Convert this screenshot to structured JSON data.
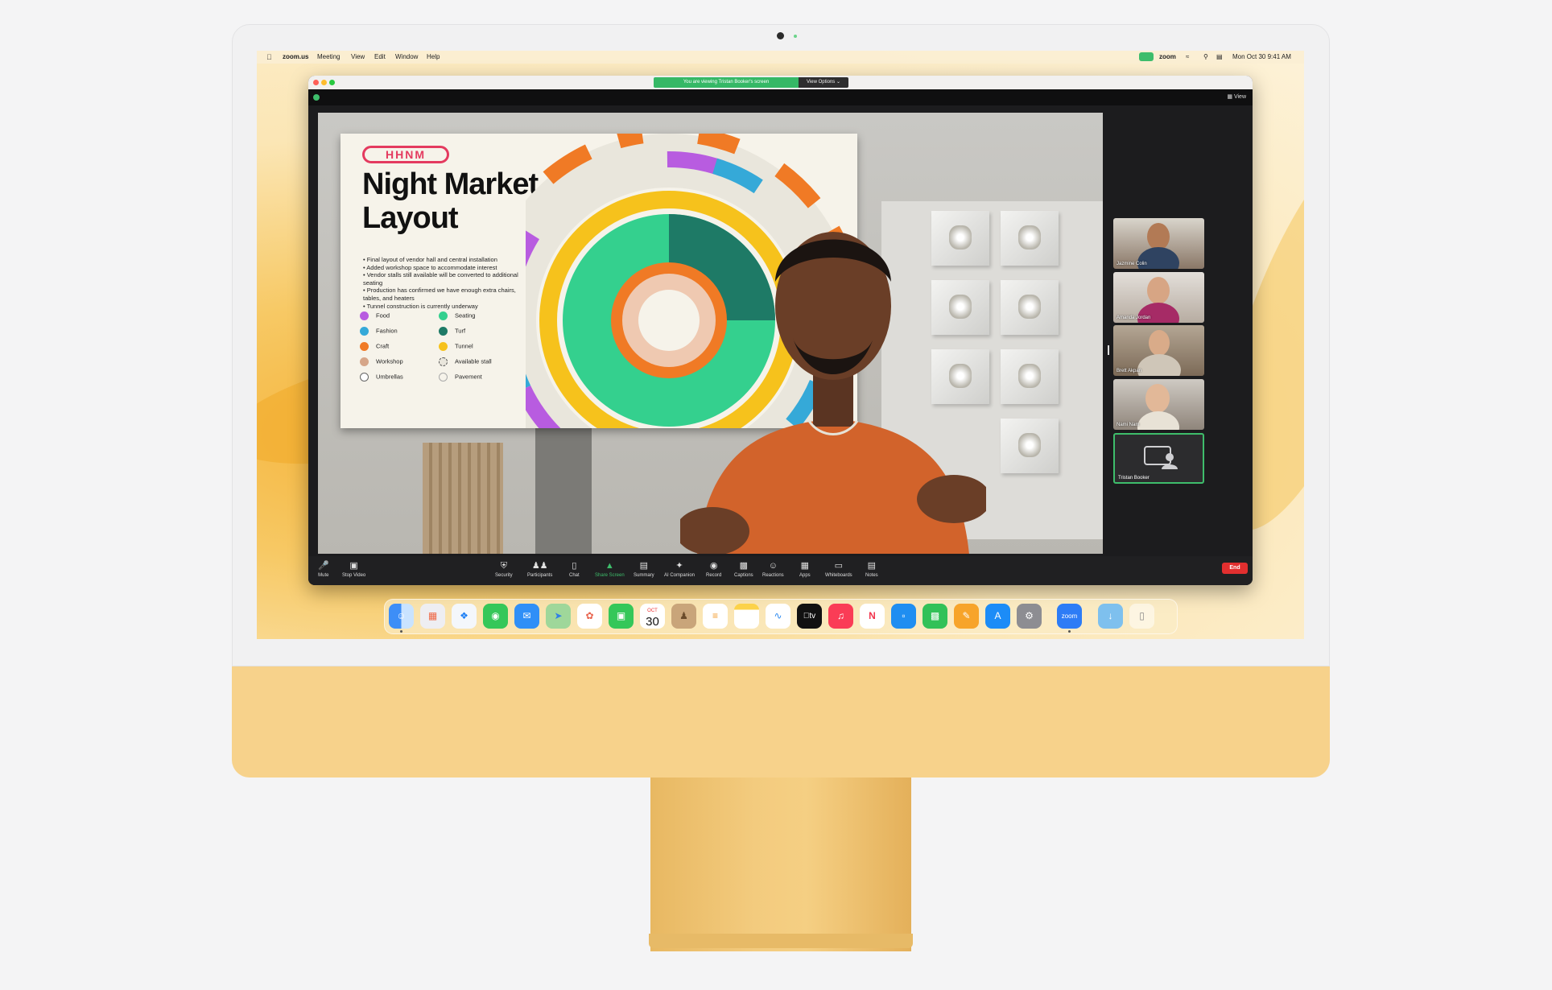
{
  "menubar": {
    "app": "zoom.us",
    "items": [
      "Meeting",
      "View",
      "Edit",
      "Window",
      "Help"
    ],
    "status_app": "zoom",
    "datetime": "Mon Oct 30  9:41 AM"
  },
  "window": {
    "banner": "You are viewing Tristan Booker's screen",
    "view_options": "View Options",
    "view_label": "View"
  },
  "slide": {
    "logo": "HHNM",
    "title": "Night Market Layout",
    "bullets": [
      "Final layout of vendor hall and central installation",
      "Added workshop space to accommodate interest",
      "Vendor stalls still available will be converted to additional seating",
      "Production has confirmed we have enough extra chairs, tables, and heaters",
      "Tunnel construction is currently underway"
    ],
    "legend": [
      {
        "label": "Food",
        "color": "#b85ce0"
      },
      {
        "label": "Fashion",
        "color": "#35a9d8"
      },
      {
        "label": "Craft",
        "color": "#f07a25"
      },
      {
        "label": "Workshop",
        "color": "#d6a689"
      },
      {
        "label": "Umbrellas",
        "color": "#ffffff"
      },
      {
        "label": "Seating",
        "color": "#34d08e"
      },
      {
        "label": "Turf",
        "color": "#1e7a66"
      },
      {
        "label": "Tunnel",
        "color": "#f6c21c"
      },
      {
        "label": "Available stall",
        "color": "#e9e6dc"
      },
      {
        "label": "Pavement",
        "color": "#f6f3ea"
      }
    ]
  },
  "participants": [
    {
      "name": "Jazmine Colin"
    },
    {
      "name": "Amanda Jordan"
    },
    {
      "name": "Brett Akpan"
    },
    {
      "name": "Nami Nam"
    },
    {
      "name": "Tristan Booker"
    }
  ],
  "toolbar": {
    "left": [
      {
        "label": "Mute",
        "icon": "microphone-icon"
      },
      {
        "label": "Stop Video",
        "icon": "video-camera-icon"
      }
    ],
    "center": [
      {
        "label": "Security",
        "icon": "shield-icon"
      },
      {
        "label": "Participants",
        "icon": "people-icon"
      },
      {
        "label": "Chat",
        "icon": "chat-bubble-icon"
      },
      {
        "label": "Share Screen",
        "icon": "share-screen-icon"
      },
      {
        "label": "Summary",
        "icon": "document-icon"
      },
      {
        "label": "AI Companion",
        "icon": "sparkle-icon"
      },
      {
        "label": "Record",
        "icon": "record-icon"
      },
      {
        "label": "Captions",
        "icon": "cc-icon"
      },
      {
        "label": "Reactions",
        "icon": "emoji-icon"
      },
      {
        "label": "Apps",
        "icon": "apps-icon"
      },
      {
        "label": "Whiteboards",
        "icon": "whiteboard-icon"
      },
      {
        "label": "Notes",
        "icon": "notes-icon"
      }
    ],
    "end": "End",
    "accent": "#3ebd6b",
    "end_color": "#e22f2f"
  },
  "dock": {
    "calendar_month": "OCT",
    "calendar_day": "30",
    "tv_label": "tv",
    "zoom_label": "zoom",
    "apps": [
      "finder-icon",
      "launchpad-icon",
      "safari-icon",
      "messages-icon",
      "mail-icon",
      "maps-icon",
      "photos-icon",
      "facetime-icon",
      "calendar-icon",
      "contacts-icon",
      "reminders-icon",
      "notes-icon",
      "freeform-icon",
      "tv-icon",
      "music-icon",
      "news-icon",
      "keynote-icon",
      "numbers-icon",
      "pages-icon",
      "app-store-icon",
      "system-settings-icon",
      "zoom-icon",
      "downloads-folder-icon",
      "trash-icon"
    ]
  }
}
